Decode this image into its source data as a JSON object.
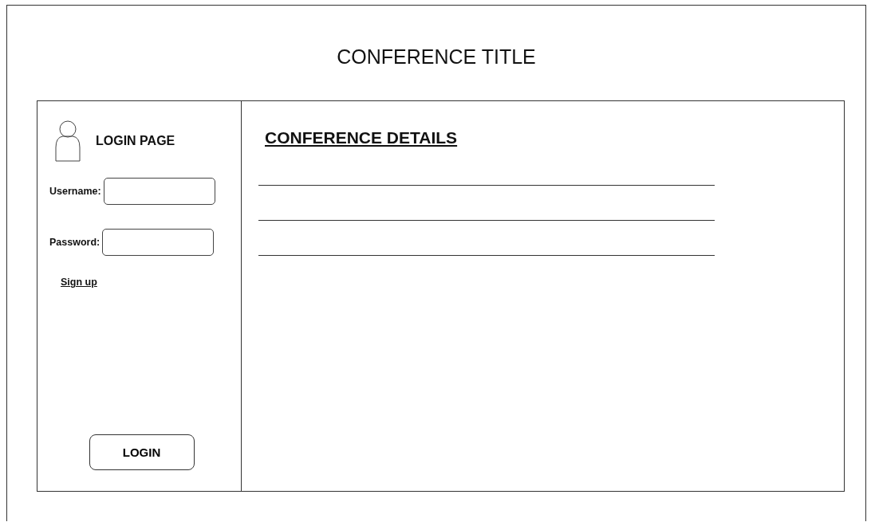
{
  "page_title": "CONFERENCE TITLE",
  "login_panel": {
    "heading": "LOGIN PAGE",
    "fields": [
      {
        "label": "Username:"
      },
      {
        "label": "Password:"
      }
    ],
    "signup_link": "Sign up",
    "login_button": "LOGIN"
  },
  "details_panel": {
    "heading": "CONFERENCE DETAILS"
  }
}
